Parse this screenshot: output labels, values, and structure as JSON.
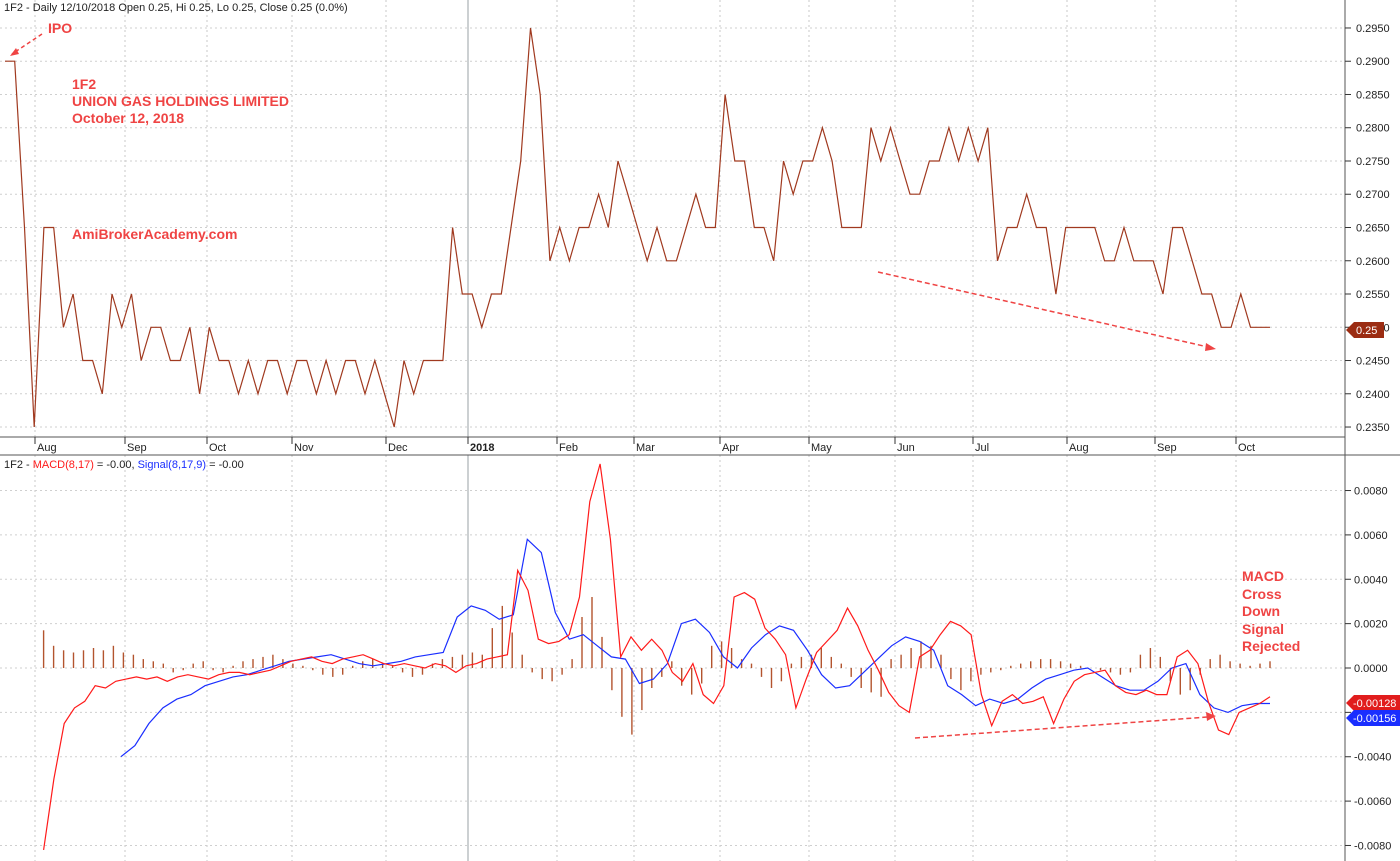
{
  "header": {
    "price_line": "1F2 - Daily 12/10/2018 Open 0.25, Hi 0.25, Lo 0.25, Close 0.25 (0.0%)",
    "macd_sym": "1F2 - ",
    "macd_name": "MACD(8,17)",
    "macd_value": " = -0.00, ",
    "signal_name": "Signal(8,17,9)",
    "signal_value": " = -0.00"
  },
  "annotations": {
    "ipo": "IPO",
    "symbol": "1F2",
    "company": "UNION GAS HOLDINGS LIMITED",
    "date": "October 12, 2018",
    "site": "AmiBrokerAcademy.com",
    "macd_note": [
      "MACD",
      "Cross",
      "Down",
      "Signal",
      "Rejected"
    ]
  },
  "badges": {
    "price_close": "0.25",
    "macd_last": "-0.00128",
    "signal_last": "-0.00156"
  },
  "colors": {
    "price": "#a0391f",
    "macd": "#ff1a1a",
    "signal": "#1a2eff",
    "histogram": "#b3542e",
    "annotation": "#ef4444",
    "badge_signal": "#1a2eff"
  },
  "chart_data": [
    {
      "type": "line",
      "name": "price",
      "months": [
        "Aug",
        "Sep",
        "Oct",
        "Nov",
        "Dec",
        "2018",
        "Feb",
        "Mar",
        "Apr",
        "May",
        "Jun",
        "Jul",
        "Aug",
        "Sep",
        "Oct"
      ],
      "series": [
        {
          "label": "close",
          "values": [
            0.29,
            0.29,
            0.265,
            0.235,
            0.265,
            0.265,
            0.25,
            0.255,
            0.245,
            0.245,
            0.24,
            0.255,
            0.25,
            0.255,
            0.245,
            0.25,
            0.25,
            0.245,
            0.245,
            0.25,
            0.24,
            0.25,
            0.245,
            0.245,
            0.24,
            0.245,
            0.24,
            0.245,
            0.245,
            0.24,
            0.245,
            0.245,
            0.24,
            0.245,
            0.24,
            0.245,
            0.245,
            0.24,
            0.245,
            0.24,
            0.235,
            0.245,
            0.24,
            0.245,
            0.245,
            0.245,
            0.265,
            0.255,
            0.255,
            0.25,
            0.255,
            0.255,
            0.265,
            0.275,
            0.295,
            0.285,
            0.26,
            0.265,
            0.26,
            0.265,
            0.265,
            0.27,
            0.265,
            0.275,
            0.27,
            0.265,
            0.26,
            0.265,
            0.26,
            0.26,
            0.265,
            0.27,
            0.265,
            0.265,
            0.285,
            0.275,
            0.275,
            0.265,
            0.265,
            0.26,
            0.275,
            0.27,
            0.275,
            0.275,
            0.28,
            0.275,
            0.265,
            0.265,
            0.265,
            0.28,
            0.275,
            0.28,
            0.275,
            0.27,
            0.27,
            0.275,
            0.275,
            0.28,
            0.275,
            0.28,
            0.275,
            0.28,
            0.26,
            0.265,
            0.265,
            0.27,
            0.265,
            0.265,
            0.255,
            0.265,
            0.265,
            0.265,
            0.265,
            0.26,
            0.26,
            0.265,
            0.26,
            0.26,
            0.26,
            0.255,
            0.265,
            0.265,
            0.26,
            0.255,
            0.255,
            0.25,
            0.25,
            0.255,
            0.25,
            0.25,
            0.25
          ],
          "x_range": [
            0,
            131
          ]
        }
      ],
      "ylim": [
        0.2335,
        0.2965
      ],
      "yticks": [
        "0.2350",
        "0.2400",
        "0.2450",
        "0.2500",
        "0.2550",
        "0.2600",
        "0.2650",
        "0.2700",
        "0.2750",
        "0.2800",
        "0.2850",
        "0.2900",
        "0.2950"
      ],
      "grid": true
    },
    {
      "type": "line",
      "name": "macd",
      "series": [
        {
          "label": "MACD(8,17)",
          "values": [
            -0.0082,
            -0.005,
            -0.0025,
            -0.0018,
            -0.0015,
            -0.0008,
            -0.0009,
            -0.0006,
            -0.0005,
            -0.0004,
            -0.0005,
            -0.0004,
            -0.0006,
            -0.0004,
            -0.0003,
            -0.0004,
            -0.0005,
            -0.0003,
            -0.0002,
            -0.0002,
            -0.0003,
            -0.0002,
            -0.0001,
            0.0001,
            0.0003,
            0.0004,
            0.0005,
            0.0003,
            0.0002,
            0.0004,
            0.0005,
            0.0006,
            0.0004,
            0.0002,
            0.0001,
            0.0002,
            0.0001,
            0.0,
            0.0002,
            0.0001,
            -0.0002,
            0.0001,
            0.0002,
            0.0004,
            0.0005,
            0.0006,
            0.0044,
            0.0035,
            0.0013,
            0.0011,
            0.0012,
            0.0015,
            0.0032,
            0.0075,
            0.0092,
            0.0058,
            0.0005,
            0.0014,
            0.0008,
            0.0013,
            0.0008,
            -0.0002,
            -0.0006,
            0.0002,
            -0.0012,
            -0.0016,
            -0.0008,
            0.0032,
            0.0034,
            0.0031,
            0.0018,
            0.0013,
            0.0006,
            -0.0018,
            -0.0005,
            0.0007,
            0.0012,
            0.0017,
            0.0027,
            0.0019,
            0.0008,
            -0.0001,
            -0.0011,
            -0.0017,
            -0.002,
            0.0005,
            0.0008,
            0.0015,
            0.0021,
            0.0019,
            0.0015,
            -0.0012,
            -0.0026,
            -0.0015,
            -0.0012,
            -0.0016,
            -0.0015,
            -0.0013,
            -0.0025,
            -0.0014,
            -0.0006,
            -0.0003,
            -0.0002,
            -0.0001,
            -0.0008,
            -0.0011,
            -0.0012,
            -0.001,
            -0.0012,
            -0.0012,
            0.0005,
            0.0008,
            0.0002,
            -0.0015,
            -0.0028,
            -0.003,
            -0.002,
            -0.0018,
            -0.0016,
            -0.0013
          ],
          "x_range": [
            4,
            131
          ]
        },
        {
          "label": "Signal(8,17,9)",
          "values": [
            -0.004,
            -0.0035,
            -0.0025,
            -0.0018,
            -0.0014,
            -0.0012,
            -0.0008,
            -0.0006,
            -0.0004,
            -0.0003,
            -0.0001,
            0.0001,
            0.0003,
            0.0004,
            0.0005,
            0.0006,
            0.0004,
            0.0002,
            0.0001,
            0.0002,
            0.0003,
            0.0005,
            0.0006,
            0.0007,
            0.0023,
            0.0028,
            0.0026,
            0.0022,
            0.0024,
            0.0058,
            0.0052,
            0.0025,
            0.0013,
            0.0015,
            0.001,
            0.0005,
            0.0004,
            -0.0007,
            -0.0005,
            0.0002,
            0.002,
            0.0022,
            0.0016,
            0.0005,
            0.0,
            0.0009,
            0.0015,
            0.0019,
            0.0017,
            0.0008,
            -0.0003,
            -0.0009,
            -0.0008,
            -0.0002,
            0.0004,
            0.001,
            0.0014,
            0.0012,
            0.0008,
            -0.0008,
            -0.0012,
            -0.0017,
            -0.0014,
            -0.0016,
            -0.0014,
            -0.0009,
            -0.0005,
            -0.0003,
            -0.0001,
            0.0,
            -0.0004,
            -0.0008,
            -0.001,
            -0.001,
            -0.0006,
            0.0,
            0.0002,
            -0.0012,
            -0.0018,
            -0.002,
            -0.0017,
            -0.0016,
            -0.0016
          ],
          "x_range": [
            12,
            131
          ]
        }
      ],
      "histogram": [
        0.0017,
        0.001,
        0.0008,
        0.0007,
        0.0008,
        0.0009,
        0.0008,
        0.001,
        0.0007,
        0.0006,
        0.0004,
        0.0003,
        0.0002,
        -0.0002,
        -0.0001,
        0.0002,
        0.0003,
        -0.0001,
        -0.0002,
        0.0001,
        0.0003,
        0.0004,
        0.0005,
        0.0006,
        0.0004,
        0.0002,
        0.0001,
        -0.0001,
        -0.0003,
        -0.0004,
        -0.0003,
        0.0001,
        0.0003,
        0.0004,
        0.0002,
        0.0001,
        -0.0002,
        -0.0004,
        -0.0003,
        0.0002,
        0.0004,
        0.0005,
        0.0006,
        0.0007,
        0.0006,
        0.0018,
        0.0028,
        0.0016,
        0.0006,
        -0.0002,
        -0.0005,
        -0.0006,
        -0.0003,
        0.0004,
        0.0023,
        0.0032,
        0.0014,
        -0.001,
        -0.0022,
        -0.003,
        -0.0019,
        -0.0009,
        -0.0004,
        0.0003,
        -0.0008,
        -0.0012,
        -0.0007,
        0.001,
        0.0012,
        0.0009,
        0.0004,
        0.0002,
        -0.0004,
        -0.0009,
        -0.0006,
        0.0002,
        0.0005,
        0.0006,
        0.0009,
        0.0005,
        0.0002,
        -0.0004,
        -0.0009,
        -0.0011,
        -0.0013,
        0.0004,
        0.0006,
        0.0009,
        0.0012,
        0.001,
        0.0006,
        -0.0005,
        -0.001,
        -0.0006,
        -0.0003,
        -0.0002,
        -0.0001,
        0.0001,
        0.0002,
        0.0003,
        0.0004,
        0.0004,
        0.0003,
        0.0002,
        0.0001,
        0.0,
        -0.0001,
        -0.0002,
        -0.0003,
        -0.0002,
        0.0006,
        0.0009,
        0.0005,
        -0.0006,
        -0.0012,
        -0.001,
        -0.0003,
        0.0004,
        0.0006,
        0.0003,
        0.0002,
        0.0001,
        0.0002,
        0.0003
      ],
      "histogram_x_range": [
        4,
        131
      ],
      "ylim": [
        -0.0087,
        0.0087
      ],
      "yticks": [
        "0.0080",
        "0.0060",
        "0.0040",
        "0.0020",
        "0.0000",
        "-0.0020",
        "-0.0040",
        "-0.0060",
        "-0.0080"
      ],
      "grid": true
    }
  ]
}
